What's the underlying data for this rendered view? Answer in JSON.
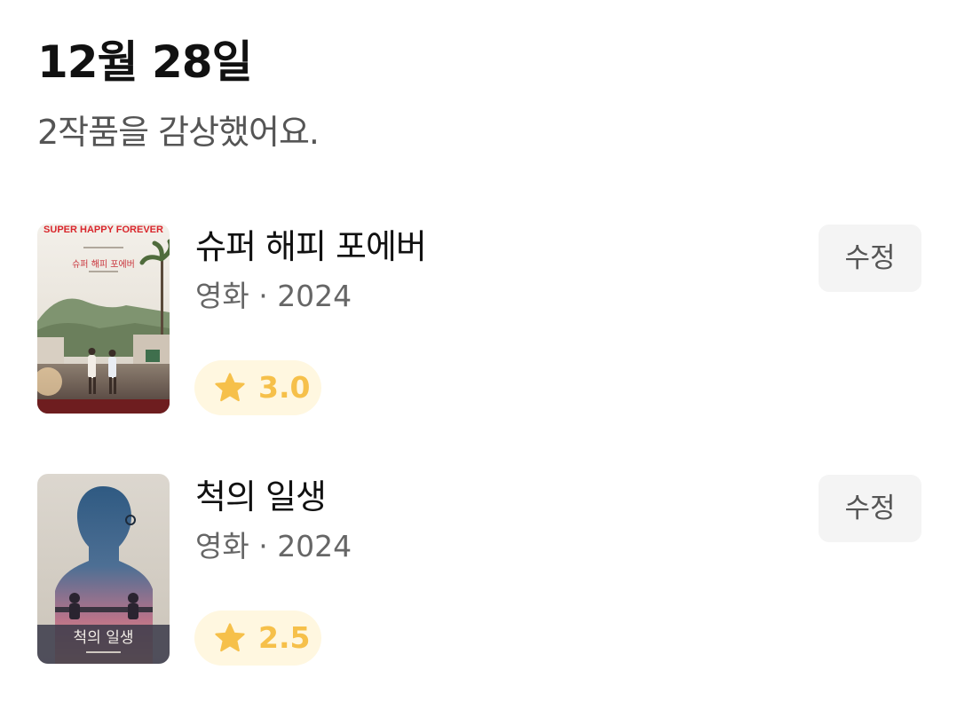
{
  "header": {
    "date": "12월 28일",
    "summary": "2작품을 감상했어요."
  },
  "entries": [
    {
      "title": "슈퍼 해피 포에버",
      "meta": "영화 · 2024",
      "rating": "3.0",
      "edit_label": "수정",
      "poster": {
        "top_text": "SUPER HAPPY FOREVER",
        "korean_title": "슈퍼 해피 포에버"
      }
    },
    {
      "title": "척의 일생",
      "meta": "영화 · 2024",
      "rating": "2.5",
      "edit_label": "수정",
      "poster": {
        "korean_title": "척의 일생"
      }
    }
  ],
  "colors": {
    "rating_accent": "#f6c04a",
    "rating_chip_bg": "#fff7e0",
    "edit_button_bg": "#f4f4f4"
  },
  "icons": {
    "rating": "star-icon"
  }
}
